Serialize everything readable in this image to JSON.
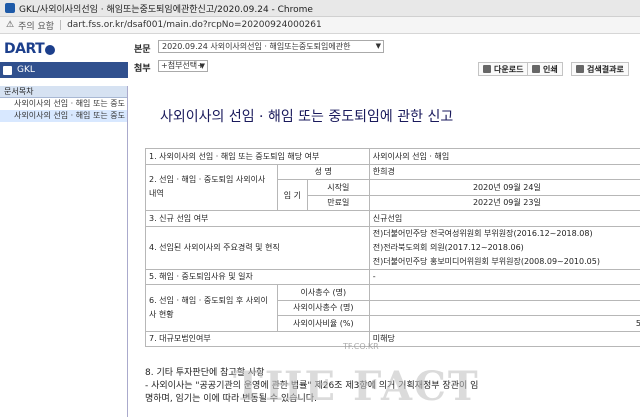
{
  "window": {
    "title": "GKL/사외이사의선임 · 해임또는중도퇴임에관한신고/2020.09.24 - Chrome"
  },
  "address": {
    "warning": "주의 요함",
    "url": "dart.fss.or.kr/dsaf001/main.do?rcpNo=20200924000261"
  },
  "header": {
    "logo": "DART",
    "company": "GKL",
    "doc_label": "본문",
    "doc_select": "2020.09.24 사외이사의선임 · 해임또는중도퇴임에관한",
    "attach_label": "첨부",
    "attach_select": "+첨부선택+",
    "download": "다운로드",
    "print": "인쇄",
    "search": "검색결과로"
  },
  "sidebar": {
    "heading": "문서목차",
    "items": [
      "사외이사의 선임 · 해임 또는 중도",
      "사외이사의 선임 · 해임 또는 중도"
    ]
  },
  "document": {
    "title": "사외이사의 선임 · 해임 또는 중도퇴임에 관한 신고",
    "rows": {
      "r1_label": "1. 사외이사의 선임 · 해임 또는 중도퇴임 해당 여부",
      "r1_value": "사외이사의 선임 · 해임",
      "r2_label": "2. 선임 · 해임 · 중도퇴임 사외이사 내역",
      "r2_name_label": "성      명",
      "r2_name_value": "한희경",
      "r2_term_label": "임   기",
      "r2_start_label": "시작일",
      "r2_start_value": "2020년 09월 24일",
      "r2_end_label": "만료일",
      "r2_end_value": "2022년 09월 23일",
      "r3_label": "3. 신규 선임 여부",
      "r3_value": "신규선임",
      "r4_label": "4. 선임된 사외이사의 주요경력 및 현직",
      "r4_v1": "전)더불어민주당 전국여성위원회 부위원장(2016.12~2018.08)",
      "r4_v2": "전)전라북도의회 의원(2017.12~2018.06)",
      "r4_v3": "전)더불어민주당 홍보미디어위원회 부위원장(2008.09~2010.05)",
      "r5_label": "5. 해임 · 중도퇴임사유 및 일자",
      "r5_value": "-",
      "r6_label": "6. 선임 · 해임 · 중도퇴임 후 사외이사 현황",
      "r6_a": "이사총수 (명)",
      "r6_b": "사외이사총수 (명)",
      "r6_c": "사외이사비율 (%)",
      "r6_c_value": "5",
      "r7_label": "7. 대규모법인여부",
      "r7_value": "미해당"
    },
    "section8": "8. 기타 투자판단에 참고할 사항",
    "note1": "- 사외이사는 \"공공기관의 운영에 관한 법률\" 제26조 제3항에 의거 기획재정부 장관이 임",
    "note2": "명하며, 임기는 이에 따라 변동될 수 있습니다."
  },
  "watermark": {
    "main": "THE FACT",
    "small": "TF.CO.KR"
  }
}
